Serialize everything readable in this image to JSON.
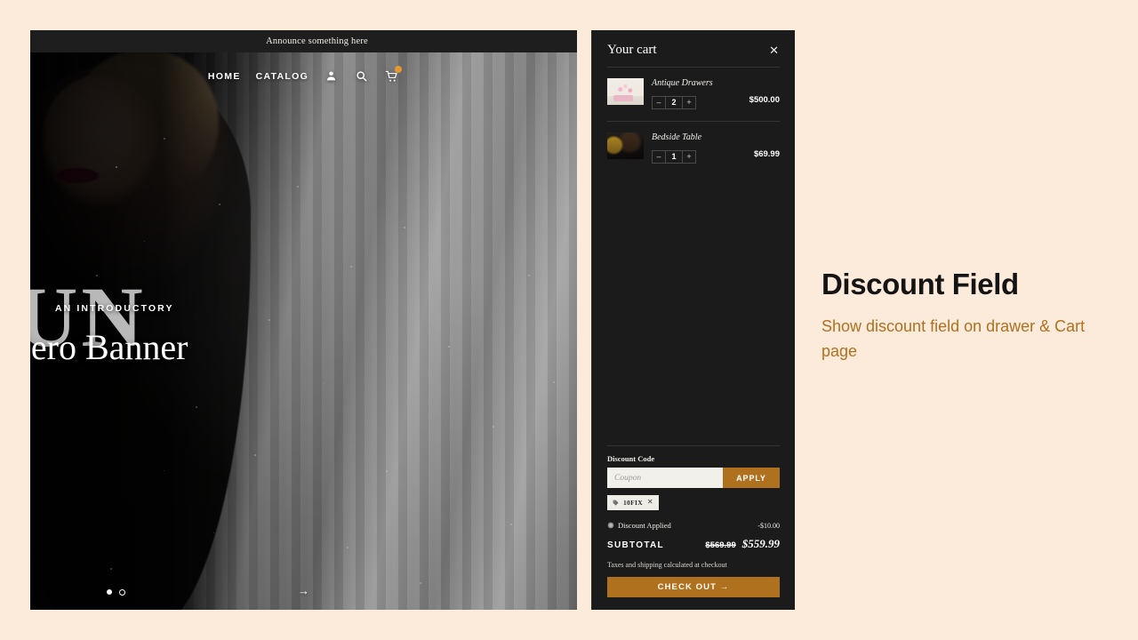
{
  "page": {
    "background_color": "#fceada",
    "accent_color": "#b0711f"
  },
  "store": {
    "announcement": "Announce something here",
    "nav": {
      "links": [
        {
          "label": "HOME"
        },
        {
          "label": "CATALOG"
        }
      ],
      "icons": [
        {
          "name": "account-icon"
        },
        {
          "name": "search-icon"
        },
        {
          "name": "cart-icon"
        }
      ]
    },
    "hero": {
      "backdrop_letters": "UN",
      "eyebrow": "AN INTRODUCTORY",
      "title": "Hero Banner",
      "next_arrow": "→",
      "slides": [
        {
          "active": false
        },
        {
          "active": true
        }
      ]
    }
  },
  "cart": {
    "title": "Your cart",
    "close_label": "✕",
    "items": [
      {
        "name": "Antique Drawers",
        "quantity": "2",
        "price": "$500.00",
        "decrement": "–",
        "increment": "+"
      },
      {
        "name": "Bedside Table",
        "quantity": "1",
        "price": "$69.99",
        "decrement": "–",
        "increment": "+"
      }
    ],
    "discount": {
      "label": "Discount Code",
      "input_value": "",
      "input_placeholder": "Coupon",
      "apply_label": "APPLY",
      "chip_code": "10FIX",
      "chip_remove": "✕",
      "applied_label": "Discount Applied",
      "applied_amount": "-$10.00"
    },
    "summary": {
      "subtotal_label": "SUBTOTAL",
      "subtotal_original": "$569.99",
      "subtotal_discounted": "$559.99",
      "taxes_note": "Taxes and shipping calculated at checkout",
      "checkout_label": "CHECK OUT →"
    }
  },
  "promo": {
    "title": "Discount Field",
    "subtitle": "Show discount  field on drawer & Cart page"
  }
}
